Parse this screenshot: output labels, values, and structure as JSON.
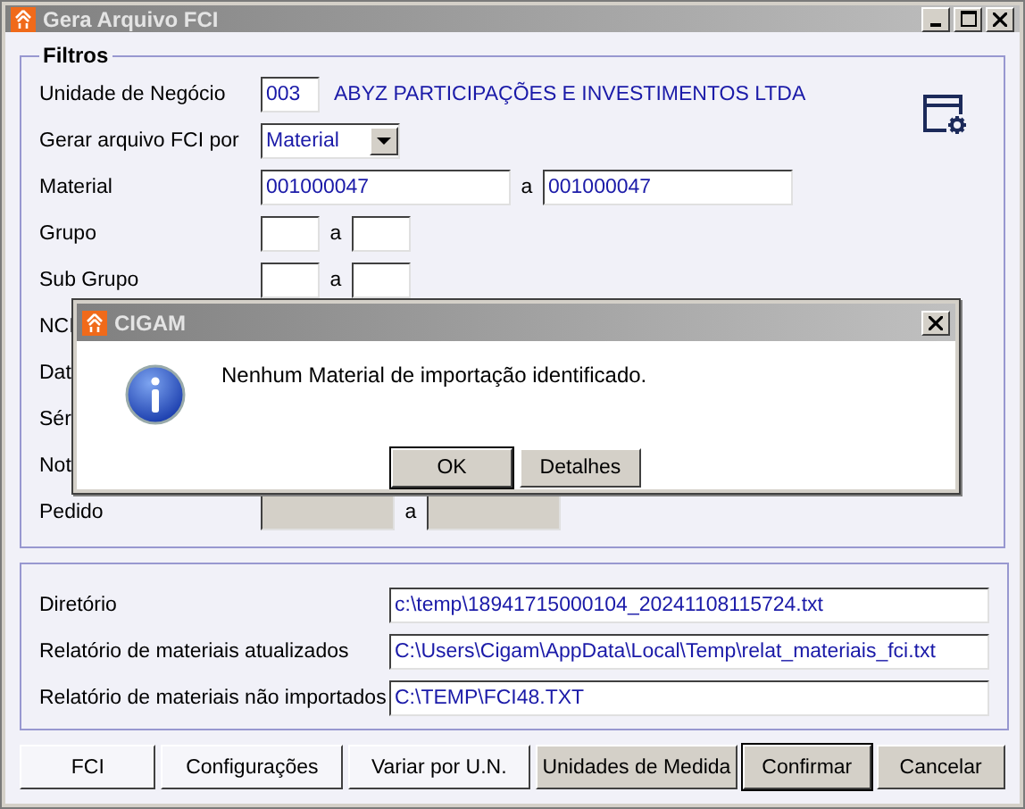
{
  "window": {
    "title": "Gera Arquivo FCI"
  },
  "filters": {
    "legend": "Filtros",
    "rows": [
      {
        "kind": "unit",
        "label": "Unidade de Negócio",
        "code": "003",
        "name": "ABYZ PARTICIPAÇÕES E INVESTIMENTOS LTDA"
      },
      {
        "kind": "select",
        "label": "Gerar arquivo FCI por",
        "value": "Material"
      },
      {
        "kind": "range",
        "label": "Material",
        "from": "001000047",
        "sep": "a",
        "to": "001000047",
        "disabled": false
      },
      {
        "kind": "range",
        "label": "Grupo",
        "from": "",
        "sep": "a",
        "to": "",
        "disabled": false
      },
      {
        "kind": "range",
        "label": "Sub Grupo",
        "from": "",
        "sep": "a",
        "to": "",
        "disabled": false
      },
      {
        "kind": "label",
        "label": "NCI"
      },
      {
        "kind": "label",
        "label": "Dat"
      },
      {
        "kind": "label",
        "label": "Sér"
      },
      {
        "kind": "label",
        "label": "Not"
      },
      {
        "kind": "range",
        "label": "Pedido",
        "from": "",
        "sep": "a",
        "to": "",
        "disabled": true
      }
    ]
  },
  "output": [
    {
      "label": "Diretório",
      "value": "c:\\temp\\18941715000104_20241108115724.txt"
    },
    {
      "label": "Relatório de materiais atualizados",
      "value": "C:\\Users\\Cigam\\AppData\\Local\\Temp\\relat_materiais_fci.txt"
    },
    {
      "label": "Relatório de materiais não importados",
      "value": "C:\\TEMP\\FCI48.TXT"
    }
  ],
  "buttons": [
    {
      "label": "FCI",
      "kind": "light",
      "default": false
    },
    {
      "label": "Configurações",
      "kind": "light",
      "default": false
    },
    {
      "label": "Variar por U.N.",
      "kind": "light",
      "default": false
    },
    {
      "label": "Unidades de Medida",
      "kind": "grey",
      "default": false
    },
    {
      "label": "Confirmar",
      "kind": "grey",
      "default": true
    },
    {
      "label": "Cancelar",
      "kind": "grey",
      "default": false
    }
  ],
  "dialog": {
    "title": "CIGAM",
    "message": "Nenhum Material de importação identificado.",
    "buttons": [
      {
        "label": "OK",
        "default": true
      },
      {
        "label": "Detalhes",
        "default": false
      }
    ]
  }
}
